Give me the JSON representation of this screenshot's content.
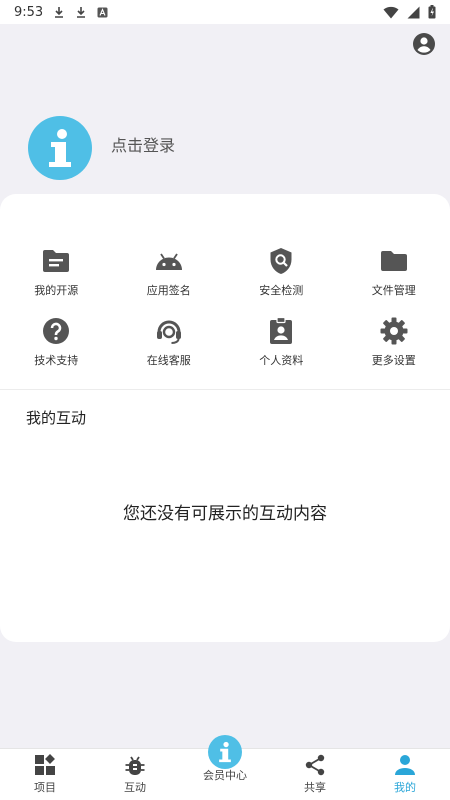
{
  "status_bar": {
    "time": "9:53"
  },
  "profile": {
    "login_prompt": "点击登录"
  },
  "grid": [
    {
      "label": "我的开源",
      "icon": "folder-doc-icon"
    },
    {
      "label": "应用签名",
      "icon": "android-icon"
    },
    {
      "label": "安全检测",
      "icon": "shield-search-icon"
    },
    {
      "label": "文件管理",
      "icon": "folder-icon"
    },
    {
      "label": "技术支持",
      "icon": "help-icon"
    },
    {
      "label": "在线客服",
      "icon": "headset-icon"
    },
    {
      "label": "个人资料",
      "icon": "id-badge-icon"
    },
    {
      "label": "更多设置",
      "icon": "gear-icon"
    }
  ],
  "interaction": {
    "title": "我的互动",
    "empty_message": "您还没有可展示的互动内容"
  },
  "bottom_nav": [
    {
      "label": "项目",
      "icon": "grid-icon"
    },
    {
      "label": "互动",
      "icon": "bug-icon"
    },
    {
      "label": "会员中心",
      "icon": "info-logo-icon"
    },
    {
      "label": "共享",
      "icon": "share-icon"
    },
    {
      "label": "我的",
      "icon": "person-icon"
    }
  ],
  "colors": {
    "accent": "#2aa6d8",
    "brand": "#4fbfe6",
    "icon": "#555555"
  }
}
